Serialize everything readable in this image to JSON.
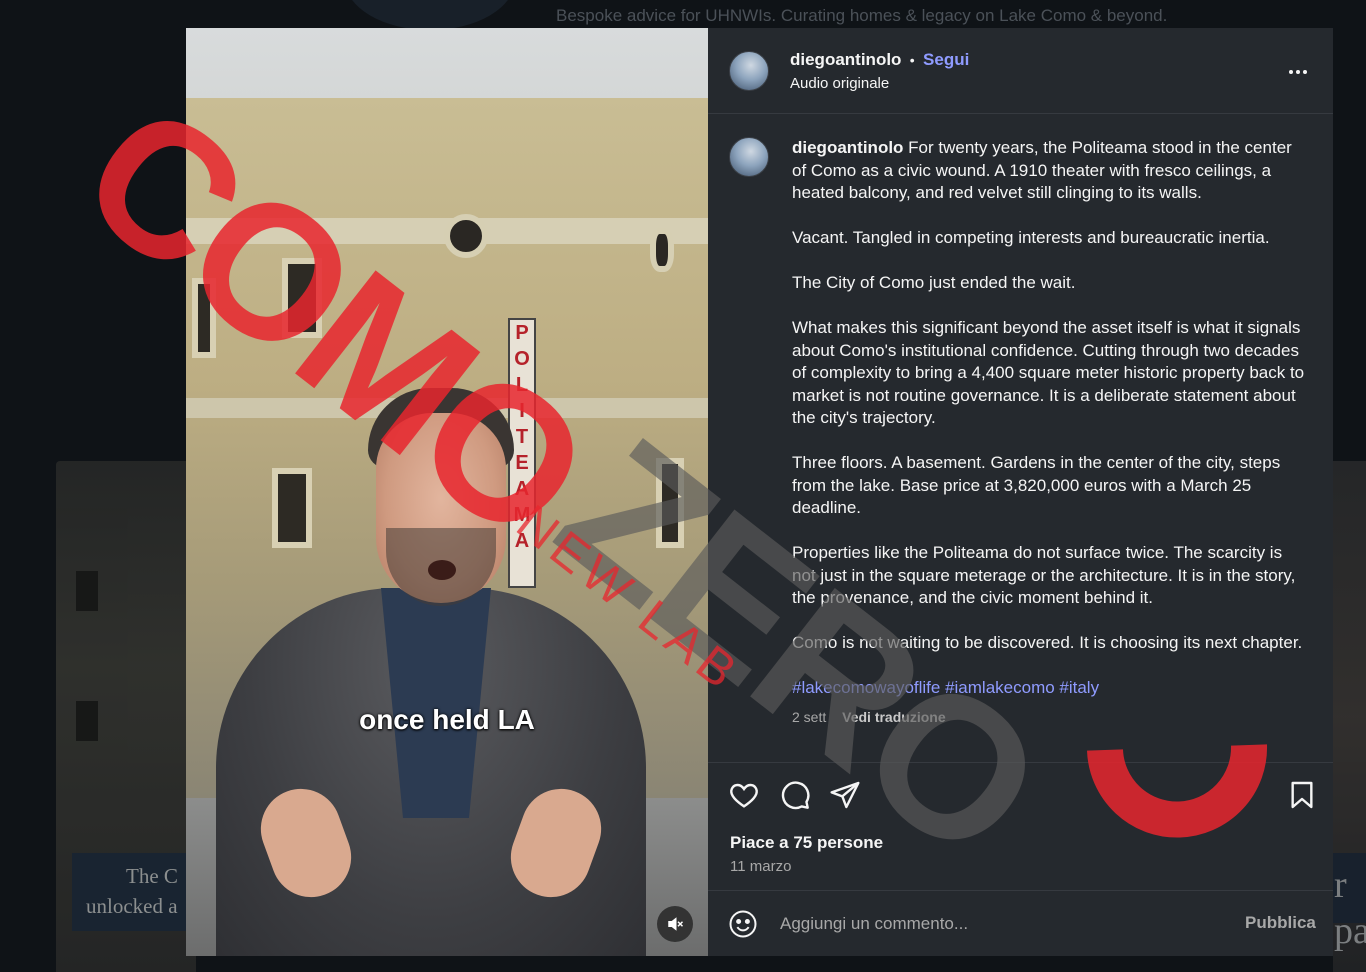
{
  "background": {
    "top_text": "Bespoke advice for UHNWIs. Curating homes & legacy on Lake Como & beyond.",
    "left_caption_line1": "The C",
    "left_caption_line2": "unlocked a",
    "right_caption_letters": [
      "r",
      "pa"
    ]
  },
  "media": {
    "caption": "once held LA",
    "sign_letters": [
      "P",
      "O",
      "L",
      "I",
      "T",
      "E",
      "A",
      "M",
      "A"
    ],
    "mute_icon": "speaker-muted-icon"
  },
  "post": {
    "username": "diegoantinolo",
    "follow_label": "Segui",
    "audio_label": "Audio originale",
    "more_icon": "more-horizontal-icon",
    "caption_paragraphs": [
      "For twenty years, the Politeama stood in the center of Como as a civic wound. A 1910 theater with fresco ceilings, a heated balcony, and red velvet still clinging to its walls.",
      "Vacant. Tangled in competing interests and bureaucratic inertia.",
      "The City of Como just ended the wait.",
      "What makes this significant beyond the asset itself is what it signals about Como's institutional confidence. Cutting through two decades of complexity to bring a 4,400 square meter historic property back to market is not routine governance. It is a deliberate statement about the city's trajectory.",
      "Three floors. A basement. Gardens in the center of the city, steps from the lake. Base price at 3,820,000 euros with a March 25 deadline.",
      "Properties like the Politeama do not surface twice. The scarcity is not just in the square meterage or the architecture. It is in the story, the provenance, and the civic moment behind it.",
      "Como is not waiting to be discovered. It is choosing its next chapter."
    ],
    "hashtags": "#lakecomowayoflife #iamlakecomo #italy",
    "time_ago": "2 sett",
    "translate_label": "Vedi traduzione",
    "likes_label": "Piace a 75 persone",
    "date_label": "11 marzo",
    "comment_placeholder": "Aggiungi un commento...",
    "publish_label": "Pubblica"
  },
  "watermark": {
    "brand_left": "COMO",
    "brand_right": "ZERO",
    "sub": "NEW LAB",
    "red": "#e8262e",
    "gray": "#5a5a5a"
  },
  "colors": {
    "link": "#8f9bff",
    "panel": "#25292e"
  }
}
